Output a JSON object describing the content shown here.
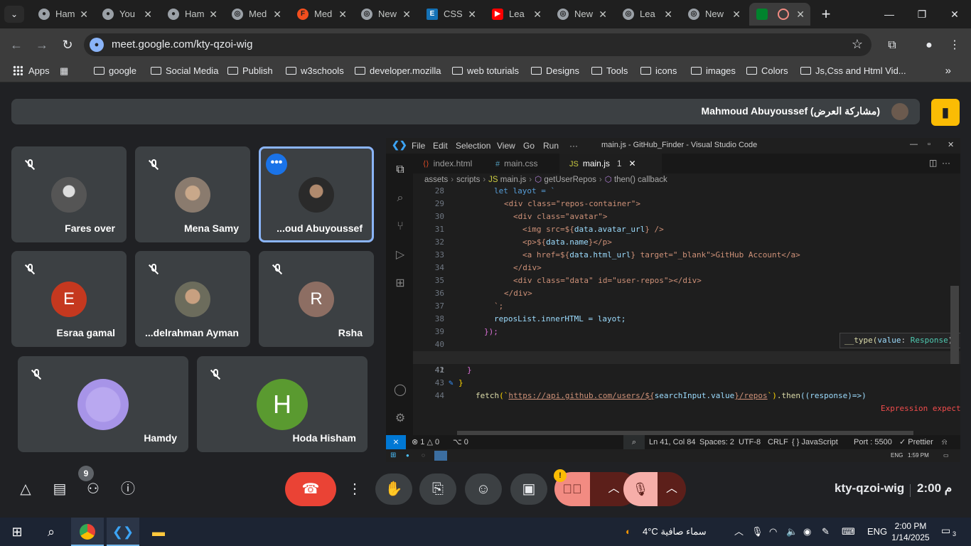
{
  "browser": {
    "tabs": [
      {
        "label": "Ham",
        "icon": "github-icon"
      },
      {
        "label": "You",
        "icon": "github-icon"
      },
      {
        "label": "Ham",
        "icon": "github-icon"
      },
      {
        "label": "Med",
        "icon": "chrome-icon"
      },
      {
        "label": "Med",
        "icon": "figma-icon"
      },
      {
        "label": "New",
        "icon": "chrome-icon"
      },
      {
        "label": "CSS",
        "icon": "css-icon"
      },
      {
        "label": "Lea",
        "icon": "youtube-icon"
      },
      {
        "label": "New",
        "icon": "chrome-icon"
      },
      {
        "label": "Lea",
        "icon": "chrome-icon"
      },
      {
        "label": "New",
        "icon": "chrome-icon"
      }
    ],
    "url": "meet.google.com/kty-qzoi-wig",
    "bookmarks": [
      "Apps",
      "google",
      "Social Media",
      "Publish",
      "w3schools",
      "developer.mozilla",
      "web toturials",
      "Designs",
      "Tools",
      "icons",
      "images",
      "Colors",
      "Js,Css and Html Vid..."
    ]
  },
  "meet": {
    "presenter": "Mahmoud Abuyoussef (مشاركة العرض)",
    "participants": [
      {
        "name": "Fares over",
        "avatar": "photo"
      },
      {
        "name": "Mena Samy",
        "avatar": "photo"
      },
      {
        "name": "...oud Abuyoussef",
        "avatar": "photo"
      },
      {
        "name": "Esraa gamal",
        "letter": "E",
        "color": "#c5381f"
      },
      {
        "name": "...delrahman Ayman",
        "avatar": "photo"
      },
      {
        "name": "Rsha",
        "letter": "R",
        "color": "#8d6e63"
      },
      {
        "name": "Hamdy",
        "avatar": "photo"
      },
      {
        "name": "Hoda Hisham",
        "letter": "H",
        "color": "#5a9a30"
      }
    ],
    "people_count": "9",
    "meeting_code": "kty-qzoi-wig",
    "time": "2:00 م",
    "camera_warning": "!"
  },
  "vscode": {
    "menu": [
      "File",
      "Edit",
      "Selection",
      "View",
      "Go",
      "Run",
      "···"
    ],
    "window_title": "main.js - GitHub_Finder - Visual Studio Code",
    "tabs": [
      {
        "icon": "html-icon",
        "label": "index.html"
      },
      {
        "icon": "css-icon",
        "label": "main.css"
      },
      {
        "icon": "js-icon",
        "label": "main.js",
        "errors": "1"
      }
    ],
    "breadcrumbs": [
      "assets",
      "scripts",
      "main.js",
      "getUserRepos",
      "then() callback"
    ],
    "line_numbers": [
      "28",
      "29",
      "30",
      "31",
      "32",
      "33",
      "34",
      "35",
      "36",
      "37",
      "38",
      "39",
      "40",
      "41",
      "42",
      "43",
      "44"
    ],
    "code": {
      "l28": "let layot = `",
      "l29": "<div class=\"repos-container\">",
      "l30": "<div class=\"avatar\">",
      "l31a": "<img src=${",
      "l31b": "data.avatar_url",
      "l31c": "} />",
      "l32a": "<p>${",
      "l32b": "data.name",
      "l32c": "}</p>",
      "l33a": "<a href=${",
      "l33b": "data.html_url",
      "l33c": "} target=\"_blank\">GitHub Account</a>",
      "l34": "</div>",
      "l35": "<div class=\"data\" id=\"user-repos\"></div>",
      "l36": "</div>",
      "l37": "`;",
      "l38": "reposList.innerHTML = layot;",
      "l39": "});",
      "l41_fetch": "fetch",
      "l41_open": "(`",
      "l41_url1": "https://api.github.com/users/${",
      "l41_var": "searchInput.value",
      "l41_url2": "}/repos",
      "l41_close": "`)",
      "l41_then": ".then",
      "l41_params": "((response)=>)",
      "l41_error": "Expression expect",
      "l42": "}",
      "l43": "}"
    },
    "hover": {
      "name": "__type(",
      "param": "value",
      "type": "Response",
      "ret": "): any"
    },
    "status": {
      "errors": "⊗ 1 △ 0",
      "ports": "⌥ 0",
      "position": "Ln 41, Col 84",
      "spaces": "Spaces: 2",
      "encoding": "UTF-8",
      "eol": "CRLF",
      "language": "{ } JavaScript",
      "port": "Port : 5500",
      "prettier": "✓ Prettier"
    },
    "inner_clock": "1:59 PM",
    "inner_lang": "ENG"
  },
  "taskbar": {
    "weather": "4°C  سماء صافية",
    "lang": "ENG",
    "time": "2:00 PM",
    "date": "1/14/2025",
    "notifications": "3"
  }
}
